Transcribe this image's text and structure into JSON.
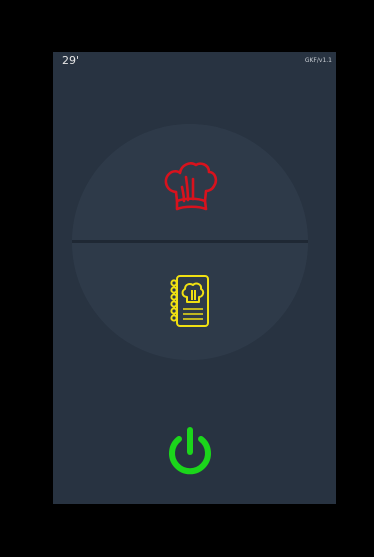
{
  "status": {
    "temperature": "29'",
    "version": "GKF/v1.1"
  },
  "menu": {
    "top": {
      "icon": "chef-hat-icon",
      "color": "#d8121d"
    },
    "bottom": {
      "icon": "recipe-book-icon",
      "color": "#f0e012"
    }
  },
  "power": {
    "icon": "power-icon",
    "color": "#1bd61b"
  },
  "colors": {
    "screen": "#283341",
    "dial": "#2e3a49",
    "frame": "#000000"
  }
}
